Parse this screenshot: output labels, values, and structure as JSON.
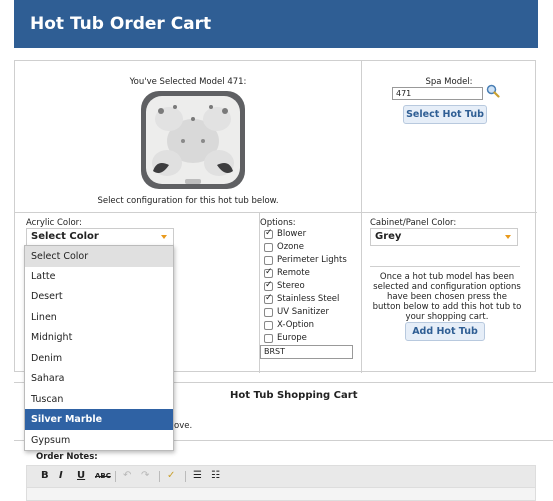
{
  "page": {
    "title": "Hot Tub Order Cart"
  },
  "selection": {
    "label": "You've Selected Model 471:",
    "config_note": "Select configuration for this hot tub below."
  },
  "spa_model": {
    "label": "Spa Model:",
    "value": "471",
    "button": "Select Hot Tub"
  },
  "acrylic": {
    "label": "Acrylic Color:",
    "selected": "Select Color",
    "options": [
      "Select Color",
      "Latte",
      "Desert",
      "Linen",
      "Midnight",
      "Denim",
      "Sahara",
      "Tuscan",
      "Silver Marble",
      "Gypsum"
    ],
    "highlighted": "Silver Marble"
  },
  "options": {
    "label": "Options:",
    "items": [
      {
        "label": "Blower",
        "checked": true
      },
      {
        "label": "Ozone",
        "checked": false
      },
      {
        "label": "Perimeter Lights",
        "checked": false
      },
      {
        "label": "Remote",
        "checked": true
      },
      {
        "label": "Stereo",
        "checked": true
      },
      {
        "label": "Stainless Steel",
        "checked": true
      },
      {
        "label": "UV Sanitizer",
        "checked": false
      },
      {
        "label": "X-Option",
        "checked": false
      },
      {
        "label": "Europe",
        "checked": false
      }
    ],
    "text_value": "BRST"
  },
  "cabinet": {
    "label": "Cabinet/Panel Color:",
    "selected": "Grey",
    "info": "Once a hot tub model has been selected and configuration options have been chosen press the button below to add this hot tub to your shopping cart.",
    "button": "Add Hot Tub"
  },
  "cart": {
    "title": "Hot Tub Shopping Cart",
    "text_fragment": "ove."
  },
  "notes": {
    "label": "Order Notes:",
    "toolbar": [
      "B",
      "I",
      "U",
      "ABC",
      "↶",
      "↷",
      "✓",
      "☰",
      "☷"
    ]
  },
  "colors": {
    "header": "#2f5e94",
    "accent": "#e99a1c",
    "highlight": "#2f62a4"
  }
}
